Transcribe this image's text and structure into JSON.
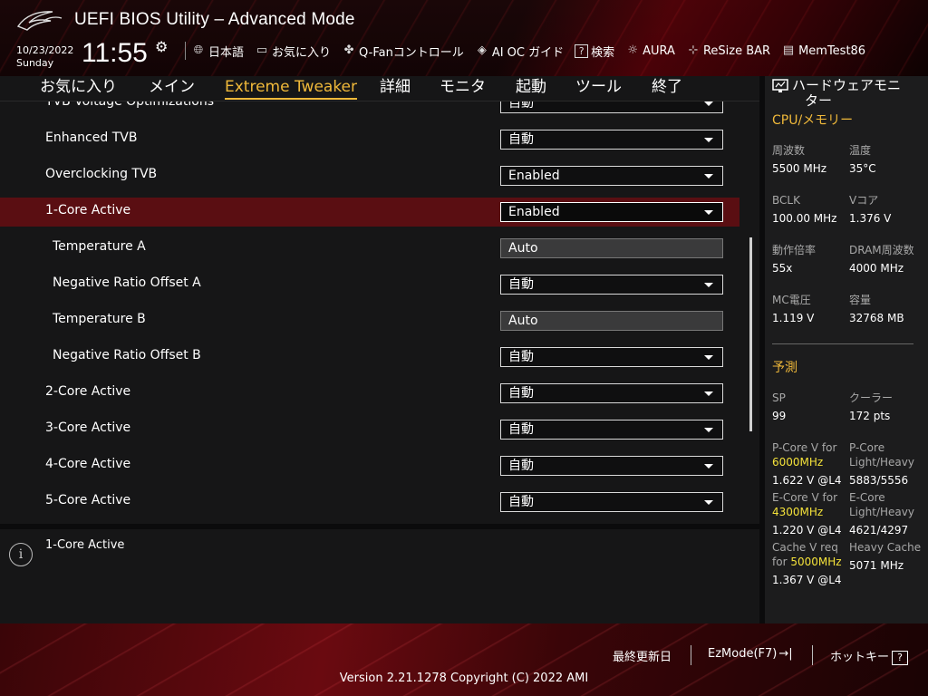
{
  "header": {
    "title": "UEFI BIOS Utility – Advanced Mode",
    "date": "10/23/2022",
    "day": "Sunday",
    "time": "11:55",
    "toolbar": [
      {
        "icon": "globe-icon",
        "label": "日本語"
      },
      {
        "icon": "favorites-icon",
        "label": "お気に入り"
      },
      {
        "icon": "fan-icon",
        "label": "Q-Fanコントロール"
      },
      {
        "icon": "ai-oc-icon",
        "label": "AI OC ガイド"
      },
      {
        "icon": "search-help-icon",
        "label": "検索"
      },
      {
        "icon": "aura-icon",
        "label": "AURA"
      },
      {
        "icon": "resize-bar-icon",
        "label": "ReSize BAR"
      },
      {
        "icon": "memtest-icon",
        "label": "MemTest86"
      }
    ]
  },
  "menu": {
    "items": [
      "お気に入り",
      "メイン",
      "Extreme Tweaker",
      "詳細",
      "モニタ",
      "起動",
      "ツール",
      "終了"
    ],
    "active": "Extreme Tweaker"
  },
  "settings": [
    {
      "label": "TVB Voltage Optimizations",
      "value": "自動",
      "type": "dropdown"
    },
    {
      "label": "Enhanced TVB",
      "value": "自動",
      "type": "dropdown"
    },
    {
      "label": "Overclocking TVB",
      "value": "Enabled",
      "type": "dropdown"
    },
    {
      "label": "1-Core Active",
      "value": "Enabled",
      "type": "dropdown",
      "selected": true
    },
    {
      "label": "Temperature A",
      "value": "Auto",
      "type": "text"
    },
    {
      "label": "Negative Ratio Offset A",
      "value": "自動",
      "type": "dropdown"
    },
    {
      "label": "Temperature B",
      "value": "Auto",
      "type": "text"
    },
    {
      "label": "Negative Ratio Offset B",
      "value": "自動",
      "type": "dropdown"
    },
    {
      "label": "2-Core Active",
      "value": "自動",
      "type": "dropdown"
    },
    {
      "label": "3-Core Active",
      "value": "自動",
      "type": "dropdown"
    },
    {
      "label": "4-Core Active",
      "value": "自動",
      "type": "dropdown"
    },
    {
      "label": "5-Core Active",
      "value": "自動",
      "type": "dropdown"
    }
  ],
  "info": {
    "text": "1-Core Active"
  },
  "hw_monitor": {
    "title_line1": "ハードウェアモニ",
    "title_line2": "ター",
    "cpu_section": "CPU/メモリー",
    "cpu": [
      {
        "k": "周波数",
        "v": "5500 MHz"
      },
      {
        "k": "温度",
        "v": "35°C"
      },
      {
        "k": "BCLK",
        "v": "100.00 MHz"
      },
      {
        "k": "Vコア",
        "v": "1.376 V"
      },
      {
        "k": "動作倍率",
        "v": "55x"
      },
      {
        "k": "DRAM周波数",
        "v": "4000 MHz"
      },
      {
        "k": "MC電圧",
        "v": "1.119 V"
      },
      {
        "k": "容量",
        "v": "32768 MB"
      }
    ],
    "predict_section": "予測",
    "sp_label": "SP",
    "sp_value": "99",
    "cooler_label": "クーラー",
    "cooler_value": "172 pts",
    "pcore_v_label": "P-Core V for",
    "pcore_v_freq": "6000MHz",
    "pcore_v_value": "1.622 V @L4",
    "pcore_lh_label1": "P-Core",
    "pcore_lh_label2": "Light/Heavy",
    "pcore_lh_value": "5883/5556",
    "ecore_v_label": "E-Core V for",
    "ecore_v_freq": "4300MHz",
    "ecore_v_value": "1.220 V @L4",
    "ecore_lh_label1": "E-Core",
    "ecore_lh_label2": "Light/Heavy",
    "ecore_lh_value": "4621/4297",
    "cache_v_label1": "Cache V req",
    "cache_v_label2": "for",
    "cache_v_freq": "5000MHz",
    "cache_v_value": "1.367 V @L4",
    "heavy_cache_label": "Heavy Cache",
    "heavy_cache_value": "5071 MHz"
  },
  "footer": {
    "last_modified": "最終更新日",
    "ezmode": "EzMode(F7)",
    "ezmode_icon": "→|",
    "hotkeys": "ホットキー",
    "hotkeys_icon": "?",
    "version": "Version 2.21.1278 Copyright (C) 2022 AMI"
  },
  "colors": {
    "accent": "#f0b93a",
    "selected_row": "#5a0e12",
    "highlight": "#f4e23a"
  }
}
